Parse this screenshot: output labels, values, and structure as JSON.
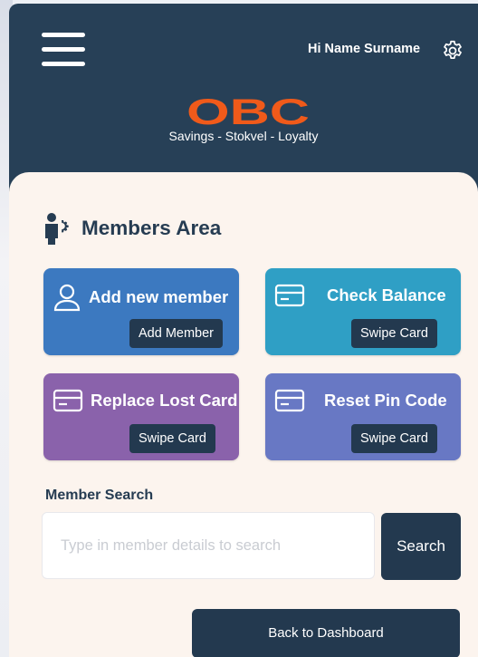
{
  "header": {
    "greeting": "Hi Name Surname",
    "logo_text": "OBC",
    "tagline": "Savings - Stokvel - Loyalty",
    "icons": {
      "menu": "hamburger-menu-icon",
      "settings": "gear-icon"
    }
  },
  "members_area": {
    "title": "Members Area",
    "cards": [
      {
        "title": "Add new member",
        "button": "Add Member",
        "icon": "user-icon",
        "color": "#3c79c0"
      },
      {
        "title": "Check Balance",
        "button": "Swipe Card",
        "icon": "card-icon",
        "color": "#2f9fc5"
      },
      {
        "title": "Replace Lost Card",
        "button": "Swipe Card",
        "icon": "card-icon",
        "color": "#8a62ab"
      },
      {
        "title": "Reset Pin Code",
        "button": "Swipe Card",
        "icon": "card-icon",
        "color": "#6878c4"
      }
    ]
  },
  "search": {
    "label": "Member Search",
    "placeholder": "Type in member details to search",
    "value": "",
    "button": "Search"
  },
  "footer": {
    "dashboard_button": "Back to Dashboard"
  },
  "colors": {
    "header_bg": "#274057",
    "panel_bg": "#fcf4ee",
    "button_dark": "#23394f",
    "logo_orange": "#f05a1a"
  }
}
